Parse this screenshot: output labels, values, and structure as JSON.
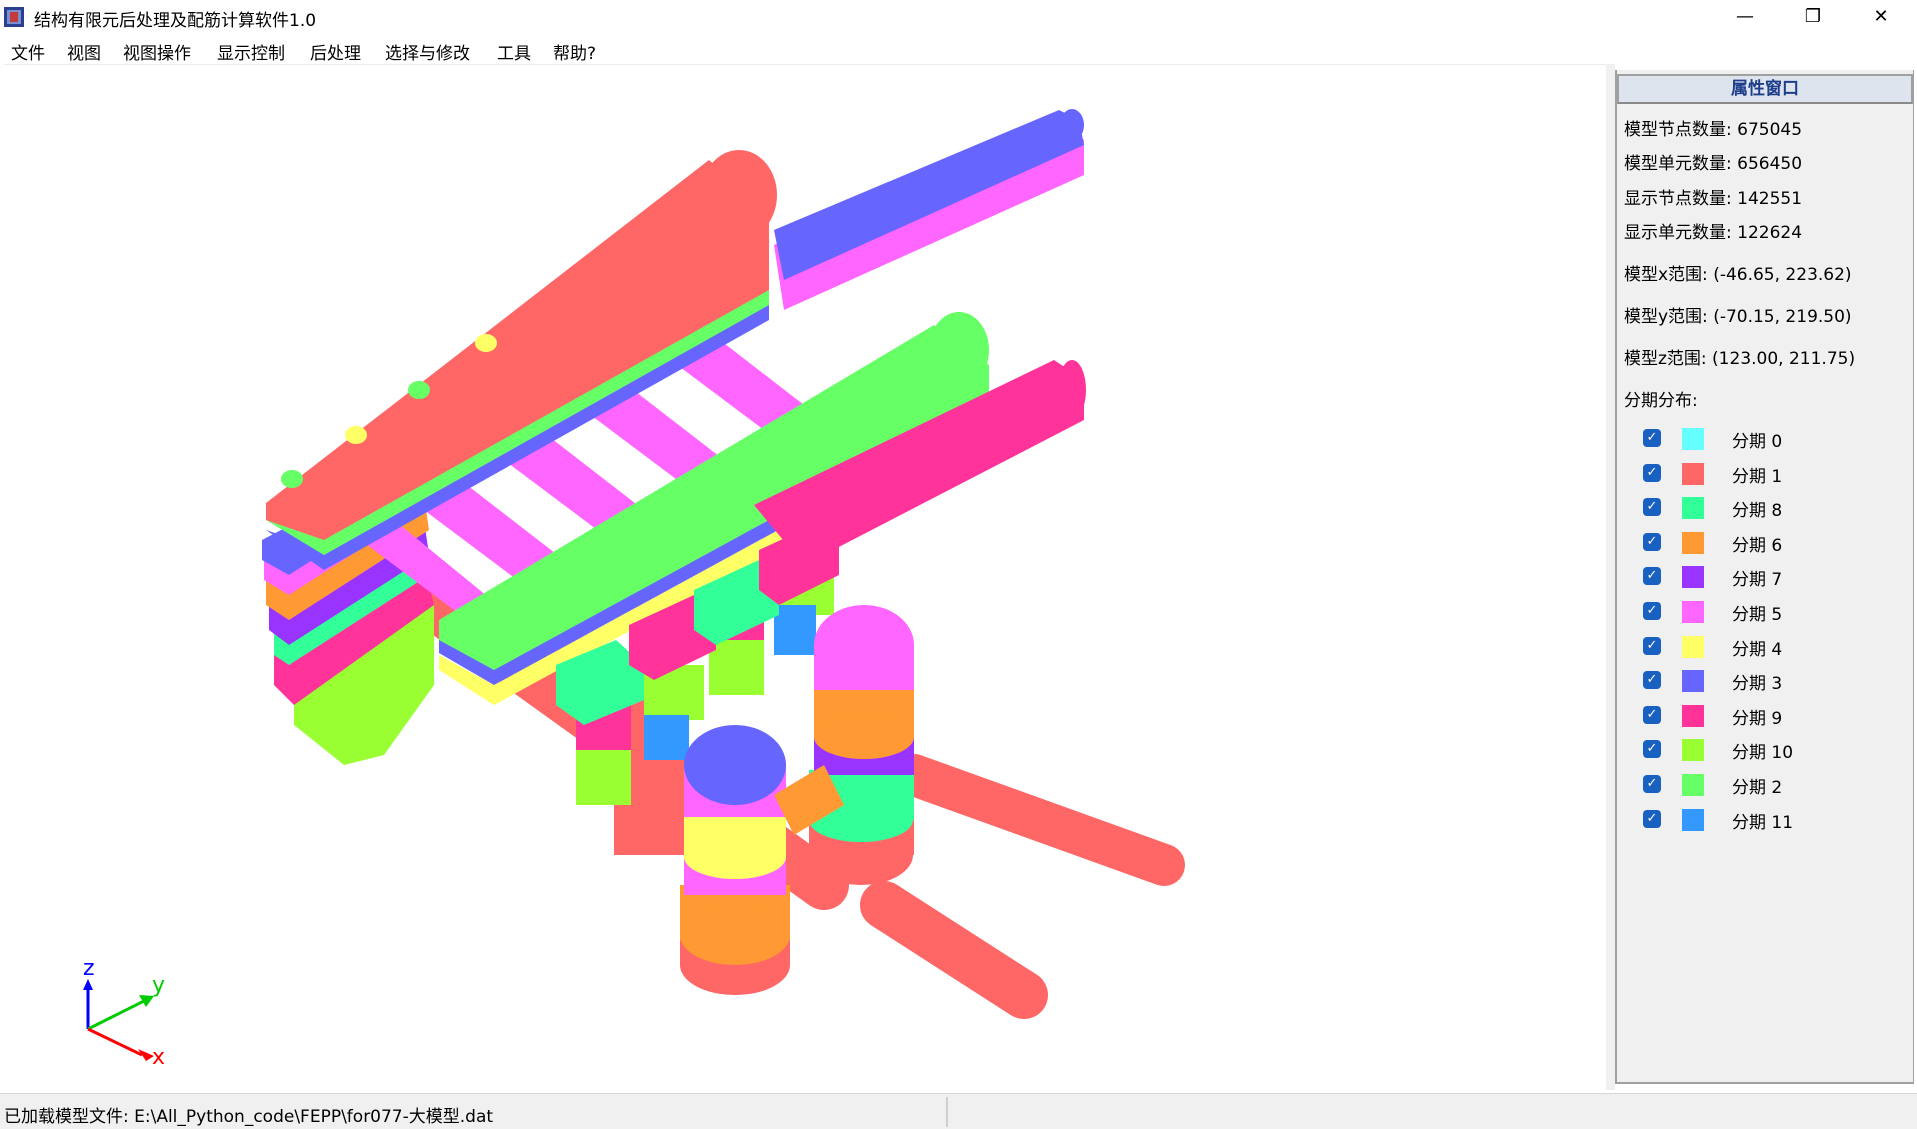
{
  "window": {
    "title": "结构有限元后处理及配筋计算软件1.0",
    "minimize_glyph": "—",
    "maximize_glyph": "❐",
    "close_glyph": "✕"
  },
  "menu": [
    {
      "label": "文件"
    },
    {
      "label": "视图"
    },
    {
      "label": "视图操作"
    },
    {
      "label": "显示控制"
    },
    {
      "label": "后处理"
    },
    {
      "label": "选择与修改"
    },
    {
      "label": "工具"
    },
    {
      "label": "帮助?"
    }
  ],
  "axes": {
    "x": "x",
    "y": "y",
    "z": "z"
  },
  "properties": {
    "title": "属性窗口",
    "model_nodes": "模型节点数量: 675045",
    "model_elements": "模型单元数量: 656450",
    "shown_nodes": "显示节点数量: 142551",
    "shown_elements": "显示单元数量: 122624",
    "x_range": "模型x范围: (-46.65, 223.62)",
    "y_range": "模型y范围: (-70.15, 219.50)",
    "z_range": "模型z范围: (123.00, 211.75)",
    "phase_header": "分期分布:",
    "phases": [
      {
        "label": "分期 0",
        "color": "#66ffff",
        "checked": true
      },
      {
        "label": "分期 1",
        "color": "#ff6666",
        "checked": true
      },
      {
        "label": "分期 8",
        "color": "#33ff99",
        "checked": true
      },
      {
        "label": "分期 6",
        "color": "#ff9933",
        "checked": true
      },
      {
        "label": "分期 7",
        "color": "#9933ff",
        "checked": true
      },
      {
        "label": "分期 5",
        "color": "#ff66ff",
        "checked": true
      },
      {
        "label": "分期 4",
        "color": "#ffff66",
        "checked": true
      },
      {
        "label": "分期 3",
        "color": "#6666ff",
        "checked": true
      },
      {
        "label": "分期 9",
        "color": "#ff3399",
        "checked": true
      },
      {
        "label": "分期 10",
        "color": "#99ff33",
        "checked": true
      },
      {
        "label": "分期 2",
        "color": "#66ff66",
        "checked": true
      },
      {
        "label": "分期 11",
        "color": "#3399ff",
        "checked": true
      }
    ]
  },
  "status": {
    "message": "已加载模型文件: E:\\All_Python_code\\FEPP\\for077-大模型.dat"
  }
}
